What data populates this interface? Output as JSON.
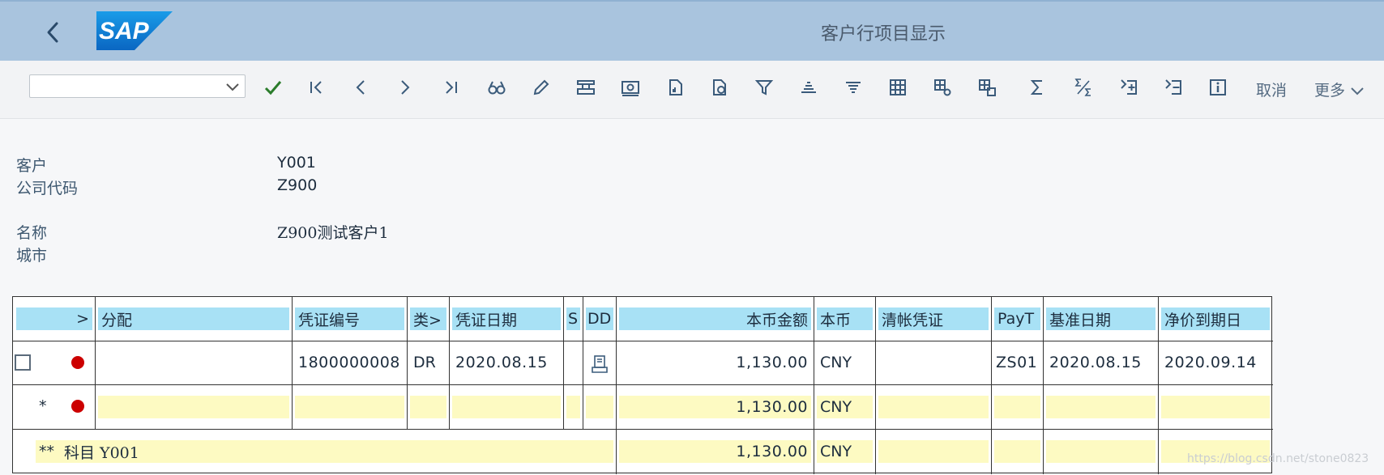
{
  "shell": {
    "title": "客户行项目显示",
    "logo_text": "SAP"
  },
  "toolbar": {
    "command_field_value": "",
    "cancel_label": "取消",
    "more_label": "更多"
  },
  "header": {
    "customer_label": "客户",
    "customer_value": "Y001",
    "company_code_label": "公司代码",
    "company_code_value": "Z900",
    "name_label": "名称",
    "name_value": "Z900测试客户1",
    "city_label": "城市",
    "city_value": ""
  },
  "table": {
    "columns": {
      "select": ">",
      "assignment": "分配",
      "doc_no": "凭证编号",
      "type": "类>",
      "doc_date": "凭证日期",
      "s": "S",
      "dd": "DD",
      "amount_lc": "本币金额",
      "currency": "本币",
      "clearing_doc": "清帐凭证",
      "payt": "PayT",
      "baseline_date": "基准日期",
      "net_due_date": "净价到期日"
    },
    "rows": [
      {
        "assignment": "",
        "doc_no": "1800000008",
        "type": "DR",
        "doc_date": "2020.08.15",
        "amount_lc": "1,130.00",
        "currency": "CNY",
        "clearing_doc": "",
        "payt": "ZS01",
        "baseline_date": "2020.08.15",
        "net_due_date": "2020.09.14",
        "status_color": "#cc0000"
      }
    ],
    "subtotal": {
      "marker": "*",
      "amount_lc": "1,130.00",
      "currency": "CNY",
      "status_color": "#cc0000"
    },
    "total": {
      "marker": "**",
      "label": "科目 Y001",
      "amount_lc": "1,130.00",
      "currency": "CNY"
    }
  },
  "watermark": "https://blog.csdn.net/stone0823",
  "colors": {
    "shell_bg": "#a9c4de",
    "header_cell": "#a8e1f5",
    "total_cell": "#fdfac2",
    "status_red": "#cc0000",
    "check_green": "#2b7c2b"
  },
  "icons": [
    "back-icon",
    "check-icon",
    "first-page-icon",
    "previous-icon",
    "next-icon",
    "last-page-icon",
    "find-icon",
    "edit-icon",
    "layout-icon",
    "currency-icon",
    "doc-attach-icon",
    "doc-globe-icon",
    "filter-icon",
    "sort-ascending-icon",
    "sort-descending-icon",
    "grid-icon",
    "grid-settings-icon",
    "grid-save-icon",
    "sum-icon",
    "subtotal-icon",
    "expand-icon",
    "collapse-icon",
    "info-icon",
    "chevron-down-icon"
  ]
}
